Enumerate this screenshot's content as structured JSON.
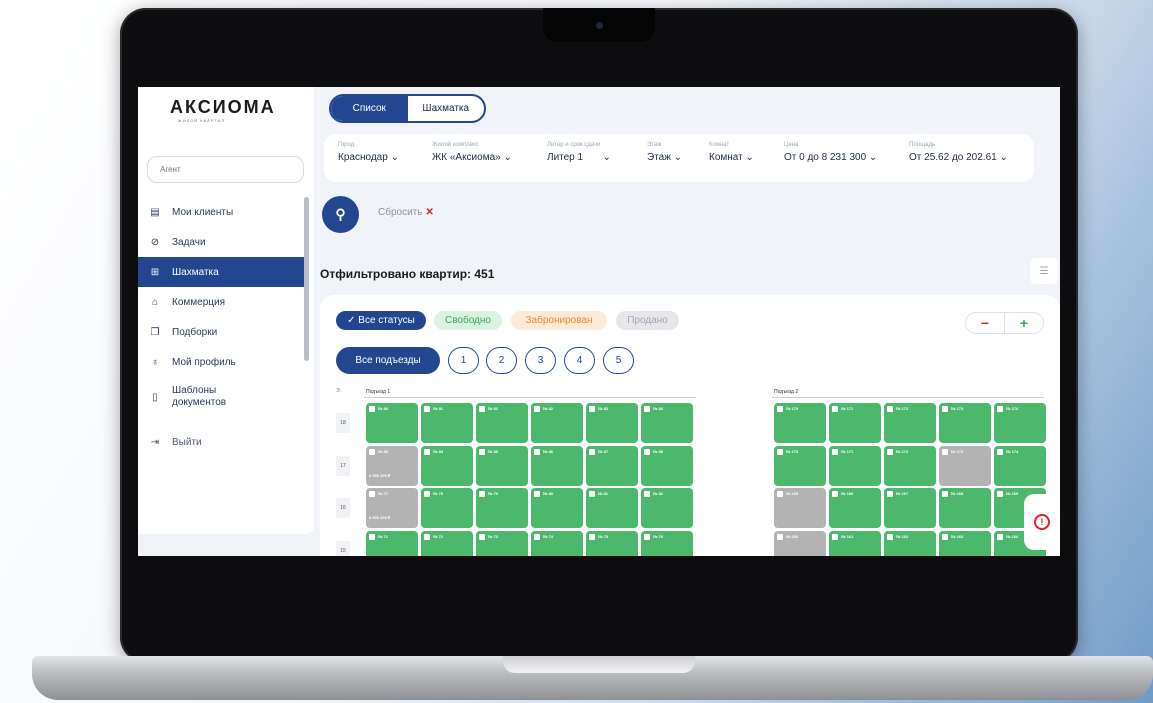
{
  "logo": {
    "name": "АКСИОМА",
    "subtitle": "ЖИЛОЙ КВАРТАЛ"
  },
  "sidebar": {
    "agent_placeholder": "Агент",
    "items": [
      {
        "label": "Мои клиенты",
        "icon": "clipboard-icon"
      },
      {
        "label": "Задачи",
        "icon": "check-circle-icon"
      },
      {
        "label": "Шахматка",
        "icon": "grid-icon",
        "active": true
      },
      {
        "label": "Коммерция",
        "icon": "home-icon"
      },
      {
        "label": "Подборки",
        "icon": "copy-icon"
      },
      {
        "label": "Мой профиль",
        "icon": "user-icon"
      },
      {
        "label": "Шаблоны документов",
        "icon": "document-icon"
      }
    ],
    "exit_label": "Выйти"
  },
  "view_toggle": {
    "list": "Список",
    "chess": "Шахматка"
  },
  "filters": [
    {
      "label": "Город",
      "value": "Краснодар"
    },
    {
      "label": "Жилой комплекс",
      "value": "ЖК «Аксиома»"
    },
    {
      "label": "Литер и срок сдачи",
      "value": "Литер 1"
    },
    {
      "label": "Этаж",
      "value": "Этаж"
    },
    {
      "label": "Комнат",
      "value": "Комнат"
    },
    {
      "label": "Цена",
      "value": "От 0 до 8 231 300"
    },
    {
      "label": "Площадь",
      "value": "От 25.62 до 202.61"
    }
  ],
  "reset_label": "Сбросить",
  "filtered_count": "Отфильтровано квартир: 451",
  "statuses": [
    {
      "label": "✓ Все статусы",
      "bg": "#22468f",
      "fg": "#ffffff"
    },
    {
      "label": "Свободно",
      "bg": "#daf3e0",
      "fg": "#3aa35a"
    },
    {
      "label": "Забронирован",
      "bg": "#fdebd8",
      "fg": "#e58a2c"
    },
    {
      "label": "Продано",
      "bg": "#e6e7ea",
      "fg": "#a4a7ad"
    }
  ],
  "zoom": {
    "minus": "−",
    "plus": "+"
  },
  "entrances": {
    "all": "Все подъезды",
    "numbers": [
      "1",
      "2",
      "3",
      "4",
      "5"
    ]
  },
  "sections": [
    {
      "title": "Подъезд 1"
    },
    {
      "title": "Подъезд 2"
    }
  ],
  "floor_head": "Э.",
  "floors": [
    "18",
    "17",
    "16",
    "15"
  ],
  "grid": {
    "section1": [
      {
        "floor": "18",
        "cells": [
          [
            "№ 80",
            "g"
          ],
          [
            "№ 81",
            "g"
          ],
          [
            "№ 81",
            "g"
          ],
          [
            "№ 82",
            "g"
          ],
          [
            "№ 83",
            "g"
          ],
          [
            "№ 83",
            "g"
          ]
        ],
        "price": ""
      },
      {
        "floor": "17",
        "cells": [
          [
            "№ 85",
            "s"
          ],
          [
            "№ 84",
            "g"
          ],
          [
            "№ 85",
            "g"
          ],
          [
            "№ 86",
            "g"
          ],
          [
            "№ 87",
            "g"
          ],
          [
            "№ 88",
            "g"
          ]
        ],
        "price": "8 956 200 ₽"
      },
      {
        "floor": "16",
        "cells": [
          [
            "№ 77",
            "s"
          ],
          [
            "№ 78",
            "g"
          ],
          [
            "№ 79",
            "g"
          ],
          [
            "№ 80",
            "g"
          ],
          [
            "№ 81",
            "g"
          ],
          [
            "№ 82",
            "g"
          ]
        ],
        "price": "8 956 200 ₽"
      },
      {
        "floor": "15",
        "cells": [
          [
            "№ 71",
            "g"
          ],
          [
            "№ 72",
            "g"
          ],
          [
            "№ 73",
            "g"
          ],
          [
            "№ 74",
            "g"
          ],
          [
            "№ 75",
            "g"
          ],
          [
            "№ 76",
            "g"
          ]
        ],
        "price": ""
      }
    ],
    "section2": [
      {
        "floor": "18",
        "cells": [
          [
            "№ 170",
            "g"
          ],
          [
            "№ 171",
            "g"
          ],
          [
            "№ 172",
            "g"
          ],
          [
            "№ 173",
            "g"
          ],
          [
            "№ 174",
            "g"
          ]
        ]
      },
      {
        "floor": "17",
        "cells": [
          [
            "№ 170",
            "g"
          ],
          [
            "№ 171",
            "g"
          ],
          [
            "№ 172",
            "g"
          ],
          [
            "№ 173",
            "s"
          ],
          [
            "№ 174",
            "g"
          ]
        ]
      },
      {
        "floor": "16",
        "cells": [
          [
            "№ 165",
            "s"
          ],
          [
            "№ 166",
            "g"
          ],
          [
            "№ 167",
            "g"
          ],
          [
            "№ 168",
            "g"
          ],
          [
            "№ 169",
            "g"
          ]
        ]
      },
      {
        "floor": "15",
        "cells": [
          [
            "№ 160",
            "s"
          ],
          [
            "№ 161",
            "g"
          ],
          [
            "№ 162",
            "g"
          ],
          [
            "№ 163",
            "g"
          ],
          [
            "№ 164",
            "g"
          ]
        ]
      }
    ]
  }
}
